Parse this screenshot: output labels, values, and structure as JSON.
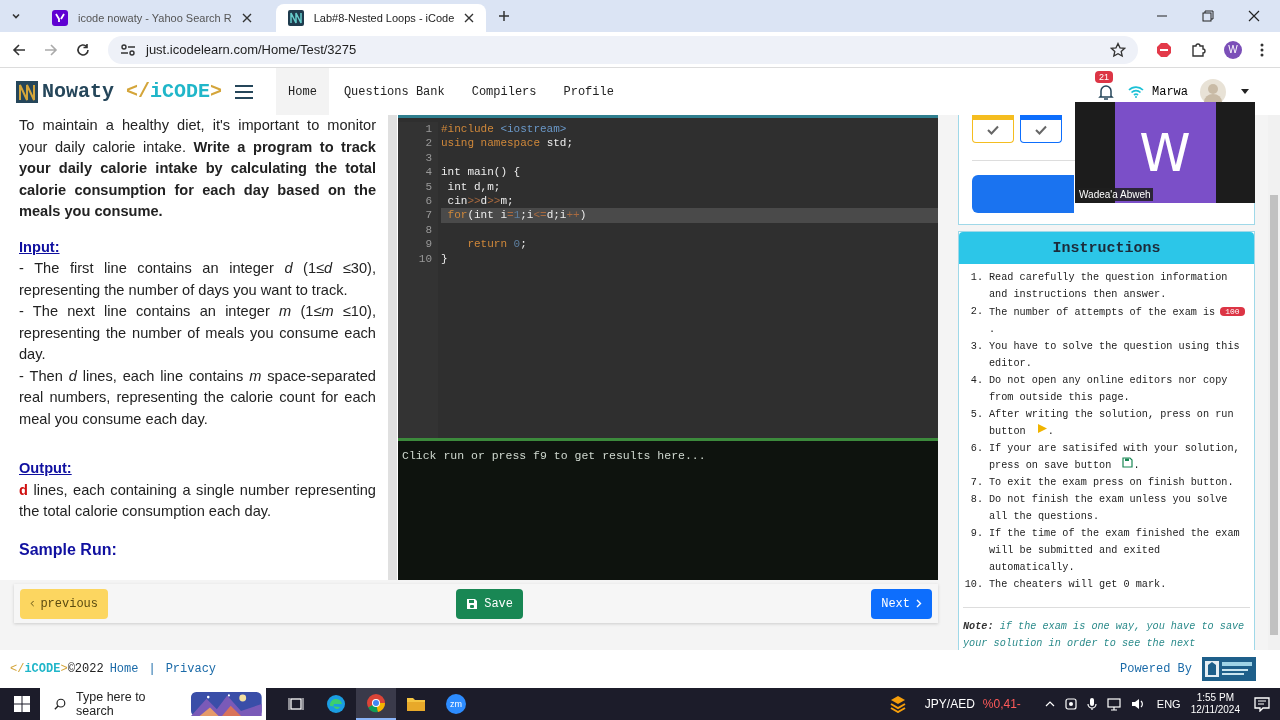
{
  "browser": {
    "tabs": [
      {
        "title": "icode nowaty - Yahoo Search R",
        "selected": false,
        "kind": "yahoo"
      },
      {
        "title": "Lab#8-Nested Loops - iCode",
        "selected": true,
        "kind": "site"
      }
    ],
    "url": "just.icodelearn.com/Home/Test/3275",
    "profile_initial": "W"
  },
  "site_nav": {
    "brand": "Nowaty",
    "brand_code": [
      {
        "kind": "bracket",
        "text": "</"
      },
      {
        "kind": "name",
        "text": "iCODE"
      },
      {
        "kind": "bracket",
        "text": ">"
      }
    ],
    "links": [
      {
        "label": "Home",
        "selected": true
      },
      {
        "label": "Questions Bank",
        "selected": false
      },
      {
        "label": "Compilers",
        "selected": false
      },
      {
        "label": "Profile",
        "selected": false
      }
    ],
    "notifications": "21",
    "user": "Marwa"
  },
  "question": {
    "blocks": [
      {
        "kind": "para",
        "text": "To maintain a healthy diet, it's important to monitor your daily calorie intake. **Write a program to track your daily calorie intake by calculating the total calorie consumption for each day based on the meals you consume.**"
      },
      {
        "kind": "heading",
        "text": "Input:"
      },
      {
        "kind": "line",
        "text": "- The first line contains an integer *d* (1≤*d* ≤30), representing the number of days you want to track."
      },
      {
        "kind": "line",
        "text": "- The next line contains an integer *m* (1≤*m* ≤10), representing the number of meals you consume each day."
      },
      {
        "kind": "line",
        "text": "- Then *d* lines, each line contains *m* space-separated real numbers, representing the calorie count for each meal you consume each day."
      },
      {
        "kind": "heading",
        "text": "Output:"
      },
      {
        "kind": "line",
        "text": "**d** lines, each containing a single number representing the total calorie consumption each day."
      },
      {
        "kind": "sample",
        "text": "Sample Run:"
      }
    ]
  },
  "editor": {
    "lines": [
      {
        "n": "1",
        "active": false,
        "tokens": [
          {
            "kind": "kw",
            "t": "#include"
          },
          {
            "kind": "str",
            "t": " <iostream>"
          }
        ]
      },
      {
        "n": "2",
        "active": false,
        "tokens": [
          {
            "kind": "kw",
            "t": "using namespace"
          },
          {
            "kind": "plain",
            "t": " std;"
          }
        ]
      },
      {
        "n": "3",
        "active": false
      },
      {
        "n": "4",
        "active": false,
        "tokens": [
          {
            "kind": "plain",
            "t": "int main() {"
          }
        ]
      },
      {
        "n": "5",
        "active": false,
        "tokens": [
          {
            "kind": "plain",
            "t": " int d,m;"
          }
        ]
      },
      {
        "n": "6",
        "active": false,
        "tokens": [
          {
            "kind": "plain",
            "t": " cin"
          },
          {
            "kind": "op",
            "t": ">>"
          },
          {
            "kind": "plain",
            "t": "d"
          },
          {
            "kind": "op",
            "t": ">>"
          },
          {
            "kind": "plain",
            "t": "m;"
          }
        ]
      },
      {
        "n": "7",
        "active": true,
        "tokens": [
          {
            "kind": "kw",
            "t": " for"
          },
          {
            "kind": "plain",
            "t": "(int i"
          },
          {
            "kind": "op",
            "t": "="
          },
          {
            "kind": "num",
            "t": "1"
          },
          {
            "kind": "plain",
            "t": ";i"
          },
          {
            "kind": "op",
            "t": "<="
          },
          {
            "kind": "plain",
            "t": "d;i"
          },
          {
            "kind": "op",
            "t": "++"
          },
          {
            "kind": "plain",
            "t": ")"
          }
        ]
      },
      {
        "n": "8",
        "active": false
      },
      {
        "n": "9",
        "active": false,
        "tokens": [
          {
            "kind": "kw",
            "t": "    return"
          },
          {
            "kind": "num",
            "t": " 0"
          },
          {
            "kind": "plain",
            "t": ";"
          }
        ]
      },
      {
        "n": "10",
        "active": false,
        "tokens": [
          {
            "kind": "plain",
            "t": "}"
          }
        ]
      }
    ],
    "output": "Click run or press f9 to get results here..."
  },
  "buttons": {
    "previous": "previous",
    "save": "Save",
    "next": "Next"
  },
  "question_tiles": [
    {
      "color": "#f5bd1f",
      "answered": true
    },
    {
      "color": "#0d6efd",
      "answered": true
    }
  ],
  "instructions": {
    "title": "Instructions",
    "items": [
      {
        "num": "1.",
        "kind": "plain",
        "text": "Read carefully the question information and instructions then answer."
      },
      {
        "num": "2.",
        "kind": "badge",
        "text": "The number of attempts of the exam is",
        "badge": "100",
        "after": "."
      },
      {
        "num": "3.",
        "kind": "plain",
        "text": "You have to solve the question using this editor."
      },
      {
        "num": "4.",
        "kind": "plain",
        "text": "Do not open any online editors nor copy from outside this page."
      },
      {
        "num": "5.",
        "kind": "run",
        "text": "After writing the solution, press on run",
        "tail": "button",
        "after": "."
      },
      {
        "num": "6.",
        "kind": "save",
        "text": "If your are satisifed with your solution,",
        "tail": "press on save button",
        "after": "."
      },
      {
        "num": "7.",
        "kind": "plain",
        "text": "To exit the exam press on finish button."
      },
      {
        "num": "8.",
        "kind": "plain",
        "text": "Do not finish the exam unless you solve all the questions."
      },
      {
        "num": "9.",
        "kind": "plain",
        "text": "If the time of the exam finished the exam will be submitted and exited automatically."
      },
      {
        "num": "10.",
        "kind": "plain",
        "text": "The cheaters will get 0 mark."
      }
    ],
    "note_label": "Note:",
    "note": "if the exam is one way, you have to save your solution in order to see the next"
  },
  "video": {
    "initial": "W",
    "name": "Wadea'a Abweh"
  },
  "footer": {
    "brand_code": [
      {
        "kind": "bracket",
        "text": "</"
      },
      {
        "kind": "name",
        "text": "iCODE"
      },
      {
        "kind": "bracket",
        "text": ">"
      }
    ],
    "copyright": "©2022",
    "links": [
      "Home",
      "Privacy"
    ],
    "separator": "|",
    "powered": "Powered By"
  },
  "taskbar": {
    "search": "Type here to search",
    "apps": [
      {
        "kind": "taskview",
        "selected": false
      },
      {
        "kind": "edge",
        "selected": false
      },
      {
        "kind": "chrome",
        "selected": true
      },
      {
        "kind": "files",
        "selected": false
      },
      {
        "kind": "zoom",
        "selected": false,
        "label": "zm"
      }
    ],
    "ticker": "JPY/AED",
    "ticker_change": "%0,41-",
    "lang": "ENG",
    "time": "1:55 PM",
    "date": "12/11/2024"
  }
}
